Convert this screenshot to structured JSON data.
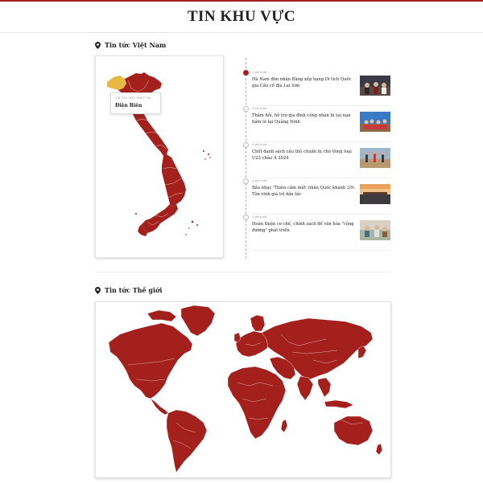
{
  "page": {
    "title": "TIN KHU VỰC"
  },
  "colors": {
    "accent": "#a4201d",
    "highlight": "#e9b840"
  },
  "vietnam": {
    "heading": "Tin tức Việt Nam",
    "icon": "location-pin-icon",
    "tooltip": {
      "label": "TIN TỨC MỚI NHẤT TẠI",
      "value": "Điện Biên"
    },
    "news": [
      {
        "time": "2 giờ trước",
        "title": "Hà Nam đón nhận Bằng xếp hạng Di tích Quốc gia Cầu cổ địa Lai Sơn"
      },
      {
        "time": "2 giờ trước",
        "title": "Thăm hỏi, hỗ trợ gia đình công nhân bị tai nạn hầm lò tại Quảng Ninh"
      },
      {
        "time": "2 giờ trước",
        "title": "Chốt danh sách cầu thủ chuẩn bị cho Vòng loại U23 châu Á 2024"
      },
      {
        "time": "2 giờ trước",
        "title": "Bảo nhạc 'Thiên cầm mất' nhân Quốc khánh 2/9: Tôn vinh giá trị dân tộc"
      },
      {
        "time": "2 giờ trước",
        "title": "Hoàn thiện cơ chế, chính sách để văn hóa \"cộng đường\" phát triển"
      }
    ]
  },
  "world": {
    "heading": "Tin tức Thế giới",
    "icon": "location-pin-icon"
  }
}
